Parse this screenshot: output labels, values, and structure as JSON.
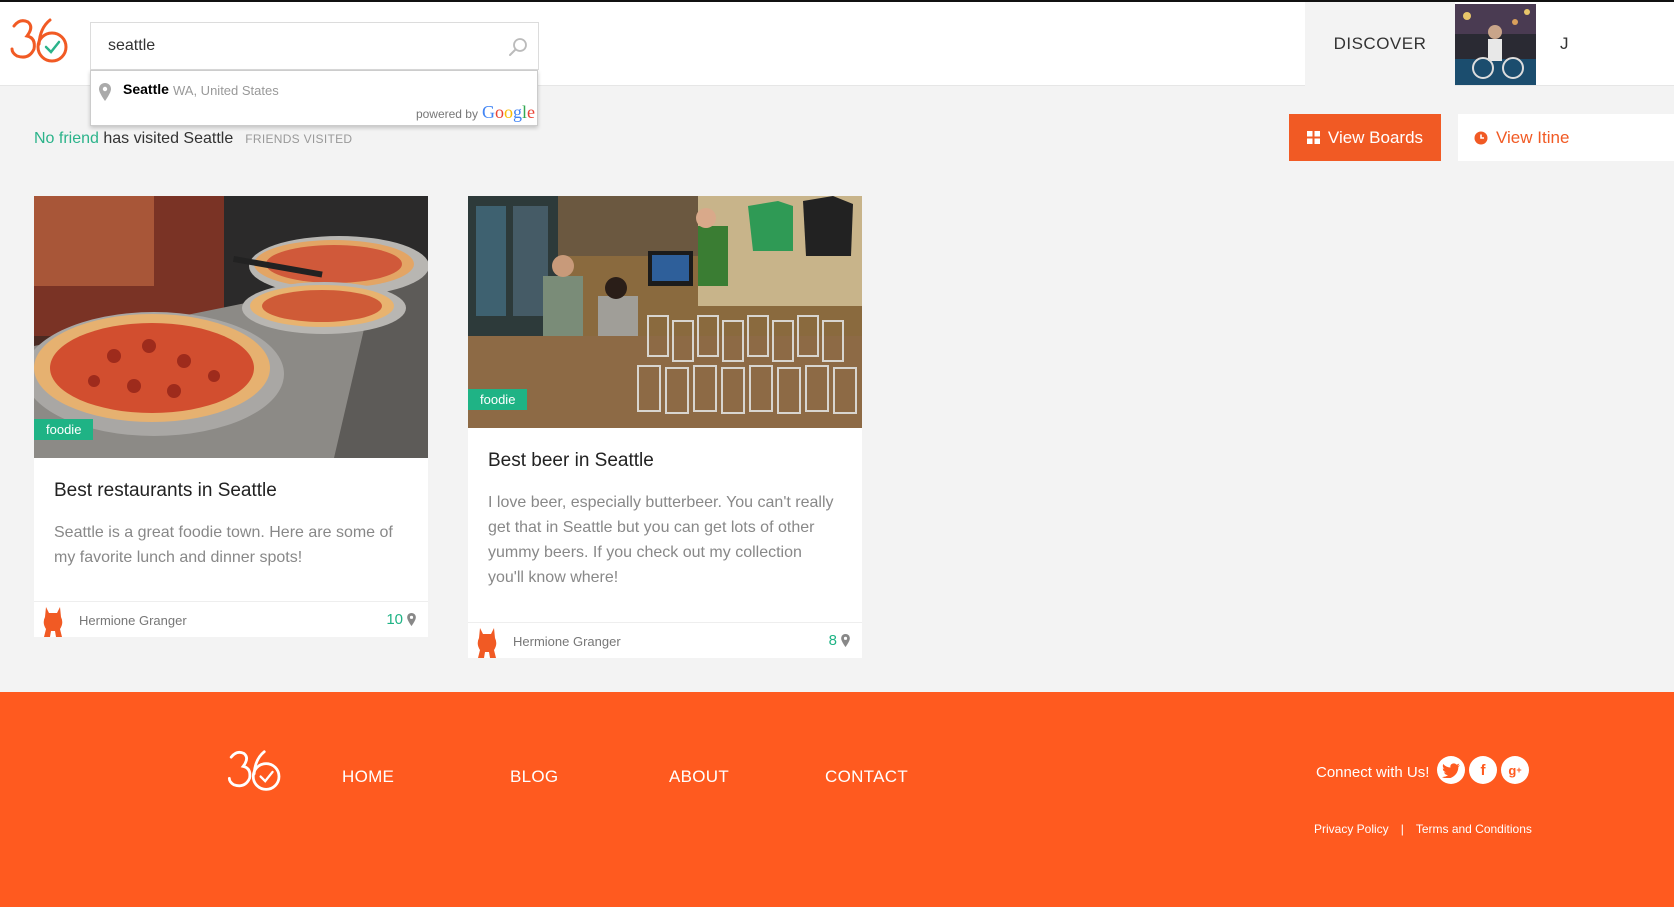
{
  "colors": {
    "brand_orange": "#f15a24",
    "footer_orange": "#ff5a1f",
    "accent_green": "#1fb385"
  },
  "search": {
    "value": "seattle"
  },
  "dropdown": {
    "city": "Seattle",
    "region": "WA, United States",
    "powered_by": "powered by",
    "provider": "Google"
  },
  "nav": {
    "discover": "DISCOVER",
    "user_initial": "J"
  },
  "friends": {
    "accent": "No friend",
    "text": " has visited Seattle",
    "label": "FRIENDS VISITED"
  },
  "buttons": {
    "view_boards": "View Boards",
    "view_itineraries": "View Itine"
  },
  "boards": [
    {
      "tag": "foodie",
      "title": "Best restaurants in Seattle",
      "description": "Seattle is a great foodie town. Here are some of my favorite lunch and dinner spots!",
      "author": "Hermione Granger",
      "count": "10"
    },
    {
      "tag": "foodie",
      "title": "Best beer in Seattle",
      "description": "I love beer, especially butterbeer. You can't really get that in Seattle but you can get lots of other yummy beers. If you check out my collection you'll know where!",
      "author": "Hermione Granger",
      "count": "8"
    }
  ],
  "footer": {
    "nav": [
      "HOME",
      "BLOG",
      "ABOUT",
      "CONTACT"
    ],
    "connect": "Connect with Us!",
    "privacy": "Privacy Policy",
    "separator": "|",
    "terms": "Terms and Conditions"
  }
}
